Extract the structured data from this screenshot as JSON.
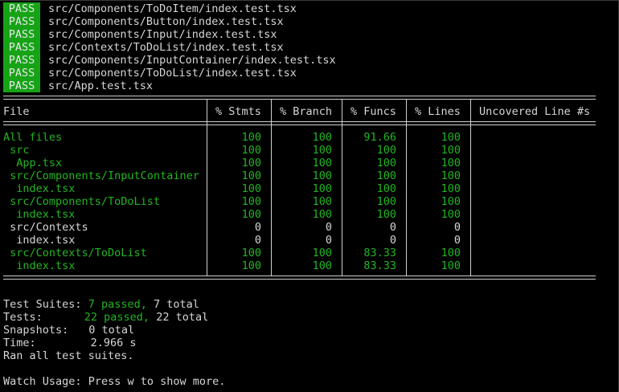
{
  "pass_results": [
    {
      "status": "PASS",
      "path": "src/Components/ToDoItem/index.test.tsx"
    },
    {
      "status": "PASS",
      "path": "src/Components/Button/index.test.tsx"
    },
    {
      "status": "PASS",
      "path": "src/Components/Input/index.test.tsx"
    },
    {
      "status": "PASS",
      "path": "src/Contexts/ToDoList/index.test.tsx"
    },
    {
      "status": "PASS",
      "path": "src/Components/InputContainer/index.test.tsx"
    },
    {
      "status": "PASS",
      "path": "src/Components/ToDoList/index.test.tsx"
    },
    {
      "status": "PASS",
      "path": "src/App.test.tsx"
    }
  ],
  "coverage": {
    "headers": [
      "File",
      "% Stmts",
      "% Branch",
      "% Funcs",
      "% Lines",
      "Uncovered Line #s"
    ],
    "rows": [
      {
        "file": "All files",
        "stmts": "100",
        "branch": "100",
        "funcs": "91.66",
        "lines": "100",
        "uncovered": "",
        "color": "green"
      },
      {
        "file": " src",
        "stmts": "100",
        "branch": "100",
        "funcs": "100",
        "lines": "100",
        "uncovered": "",
        "color": "green"
      },
      {
        "file": "  App.tsx",
        "stmts": "100",
        "branch": "100",
        "funcs": "100",
        "lines": "100",
        "uncovered": "",
        "color": "green"
      },
      {
        "file": " src/Components/InputContainer",
        "stmts": "100",
        "branch": "100",
        "funcs": "100",
        "lines": "100",
        "uncovered": "",
        "color": "green"
      },
      {
        "file": "  index.tsx",
        "stmts": "100",
        "branch": "100",
        "funcs": "100",
        "lines": "100",
        "uncovered": "",
        "color": "green"
      },
      {
        "file": " src/Components/ToDoList",
        "stmts": "100",
        "branch": "100",
        "funcs": "100",
        "lines": "100",
        "uncovered": "",
        "color": "green"
      },
      {
        "file": "  index.tsx",
        "stmts": "100",
        "branch": "100",
        "funcs": "100",
        "lines": "100",
        "uncovered": "",
        "color": "green"
      },
      {
        "file": " src/Contexts",
        "stmts": "0",
        "branch": "0",
        "funcs": "0",
        "lines": "0",
        "uncovered": "",
        "color": "white"
      },
      {
        "file": "  index.tsx",
        "stmts": "0",
        "branch": "0",
        "funcs": "0",
        "lines": "0",
        "uncovered": "",
        "color": "white"
      },
      {
        "file": " src/Contexts/ToDoList",
        "stmts": "100",
        "branch": "100",
        "funcs": "83.33",
        "lines": "100",
        "uncovered": "",
        "color": "green"
      },
      {
        "file": "  index.tsx",
        "stmts": "100",
        "branch": "100",
        "funcs": "83.33",
        "lines": "100",
        "uncovered": "",
        "color": "green"
      }
    ]
  },
  "summary": {
    "suites_label": "Test Suites:",
    "suites_passed": "7 passed,",
    "suites_total": "7 total",
    "tests_label": "Tests:",
    "tests_passed": "22 passed,",
    "tests_total": "22 total",
    "snapshots_label": "Snapshots:",
    "snapshots_value": "0 total",
    "time_label": "Time:",
    "time_value": "2.966 s",
    "ran_all": "Ran all test suites."
  },
  "watch": {
    "label": "Watch Usage:",
    "hint": "Press w to show more."
  },
  "colors": {
    "pass_bg": "#16a316",
    "green_text": "#22b522",
    "default_text": "#d6d6d6",
    "background": "#000000"
  }
}
